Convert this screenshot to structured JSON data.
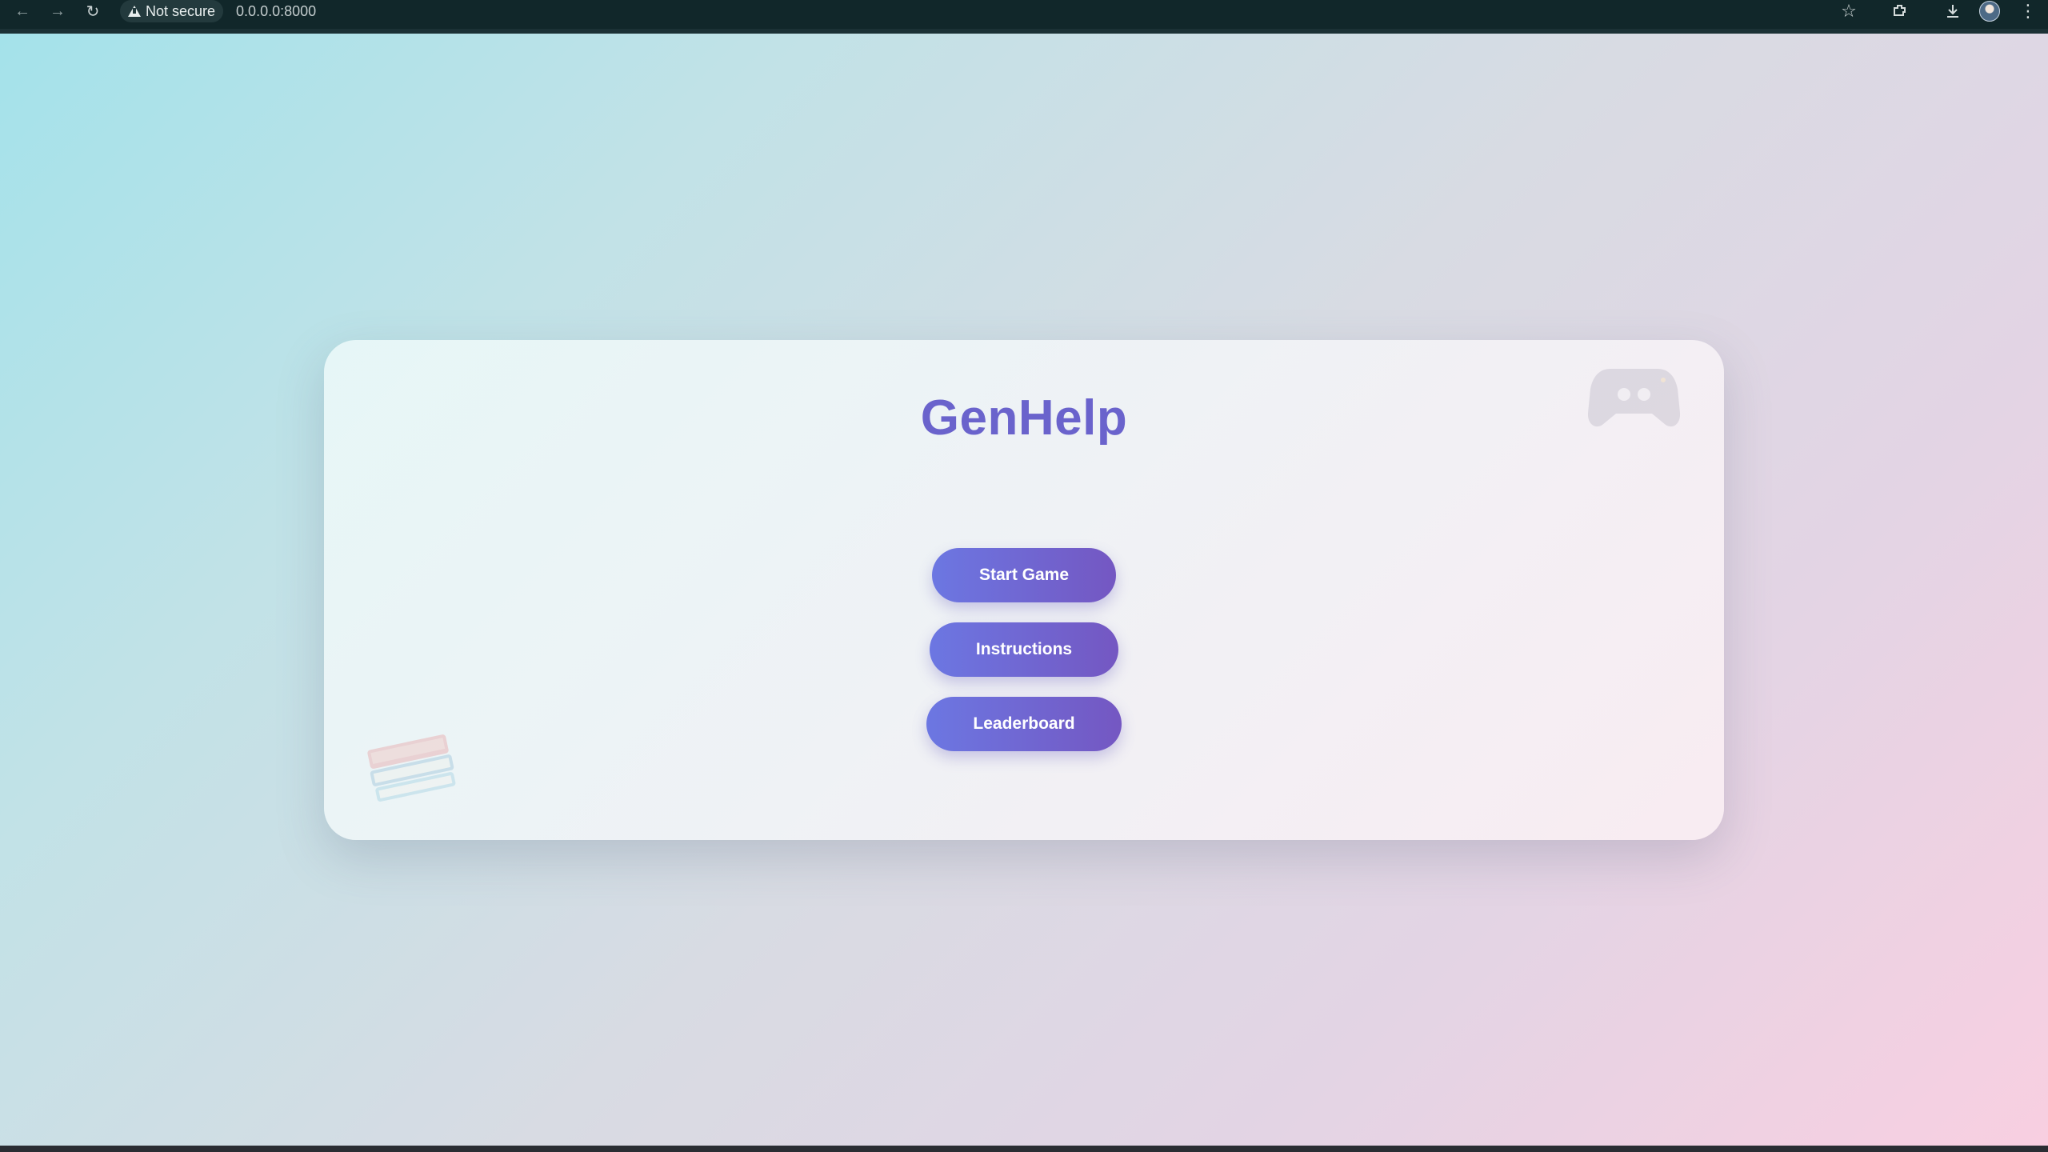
{
  "browser": {
    "security_label": "Not secure",
    "url": "0.0.0.0:8000",
    "icons": {
      "back": "back-arrow-icon",
      "forward": "forward-arrow-icon",
      "reload": "reload-icon",
      "warning": "warning-triangle-icon",
      "bookmark": "star-icon",
      "extensions": "extensions-icon",
      "downloads": "download-icon",
      "profile": "avatar-icon",
      "menu": "kebab-menu-icon"
    }
  },
  "app": {
    "title": "GenHelp",
    "buttons": {
      "start": "Start Game",
      "instructions": "Instructions",
      "leaderboard": "Leaderboard"
    },
    "decorations": {
      "top_right": "gamepad-icon",
      "bottom_left": "books-icon"
    },
    "colors": {
      "title": "#6a63cc",
      "button_start": "#6c77e2",
      "button_end": "#7457c2",
      "background_start": "#a4e2ea",
      "background_end": "#f8cfe1"
    }
  }
}
